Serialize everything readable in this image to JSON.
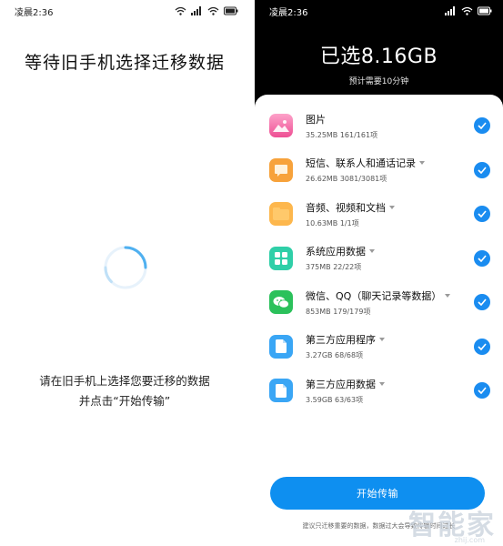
{
  "left_screen": {
    "status_time": "凌晨2:36",
    "title": "等待旧手机选择迁移数据",
    "instruction_line1": "请在旧手机上选择您要迁移的数据",
    "instruction_line2": "并点击“开始传输”"
  },
  "right_screen": {
    "status_time": "凌晨2:36",
    "selected_total": "已选8.16GB",
    "estimated_time": "预计需要10分钟",
    "items": [
      {
        "name": "图片",
        "meta": "35.25MB  161/161项",
        "icon": "photos-icon",
        "color": "#f46aa7",
        "has_caret": false,
        "checked": true
      },
      {
        "name": "短信、联系人和通话记录",
        "meta": "26.62MB  3081/3081项",
        "icon": "messages-icon",
        "color": "#f7a23b",
        "has_caret": true,
        "checked": true
      },
      {
        "name": "音频、视频和文档",
        "meta": "10.63MB  1/1项",
        "icon": "folder-icon",
        "color": "#fdb74d",
        "has_caret": true,
        "checked": true
      },
      {
        "name": "系统应用数据",
        "meta": "375MB  22/22项",
        "icon": "apps-grid-icon",
        "color": "#2fcfa8",
        "has_caret": true,
        "checked": true
      },
      {
        "name": "微信、QQ（聊天记录等数据）",
        "meta": "853MB  179/179项",
        "icon": "wechat-icon",
        "color": "#2bc15b",
        "has_caret": true,
        "checked": true
      },
      {
        "name": "第三方应用程序",
        "meta": "3.27GB  68/68项",
        "icon": "file-icon",
        "color": "#3aa6f5",
        "has_caret": true,
        "checked": true
      },
      {
        "name": "第三方应用数据",
        "meta": "3.59GB  63/63项",
        "icon": "file-icon",
        "color": "#3aa6f5",
        "has_caret": true,
        "checked": true
      }
    ],
    "start_button": "开始传输",
    "footnote": "建议只迁移重要的数据，数据过大会导致传输时间过长"
  },
  "watermark": {
    "text": "智能家",
    "sub": "zhij.com"
  }
}
